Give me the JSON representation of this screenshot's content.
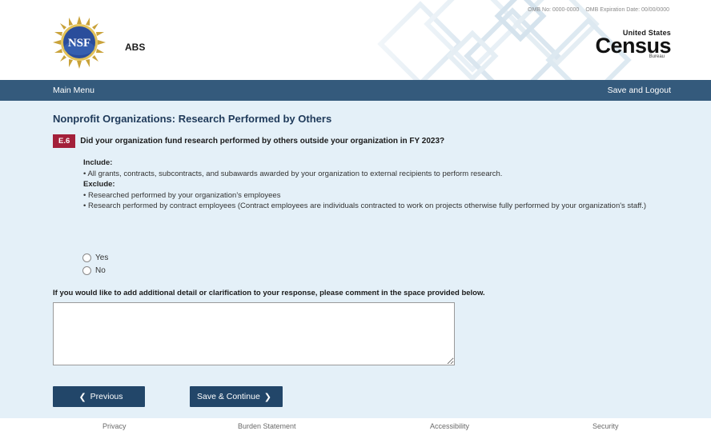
{
  "header": {
    "top_links": [
      "OMB No: 0000-0000",
      "OMB Expiration Date: 00/00/0000"
    ],
    "app_name": "ABS",
    "nsf_logo_text": "NSF",
    "census_logo": {
      "line1": "United States",
      "word": "Census",
      "line3": "Bureau"
    }
  },
  "menubar": {
    "main_menu": "Main Menu",
    "save_logout": "Save and Logout"
  },
  "main": {
    "page_title": "Nonprofit Organizations: Research Performed by Others",
    "question": {
      "number": "E.6",
      "text": "Did your organization fund research performed by others outside your organization in FY 2023?"
    },
    "include_label": "Include:",
    "include_items": [
      "• All grants, contracts, subcontracts, and subawards awarded by your organization to external recipients to perform research."
    ],
    "exclude_label": "Exclude:",
    "exclude_items": [
      "• Researched performed by your organization's employees",
      "• Research performed by contract employees (Contract employees are individuals contracted to work on projects otherwise fully performed by your organization's staff.)"
    ],
    "options": [
      "Yes",
      "No"
    ],
    "comment_label": "If you would like to add additional detail or clarification to your response, please comment in the space provided below.",
    "comment_value": ""
  },
  "buttons": {
    "previous": "Previous",
    "save_continue": "Save & Continue"
  },
  "footer": {
    "privacy": "Privacy",
    "burden": "Burden Statement",
    "accessibility": "Accessibility",
    "security": "Security"
  },
  "colors": {
    "menubar": "#345a7c",
    "button": "#224669",
    "badge": "#a3203a",
    "main_bg": "#e4f0f8"
  }
}
